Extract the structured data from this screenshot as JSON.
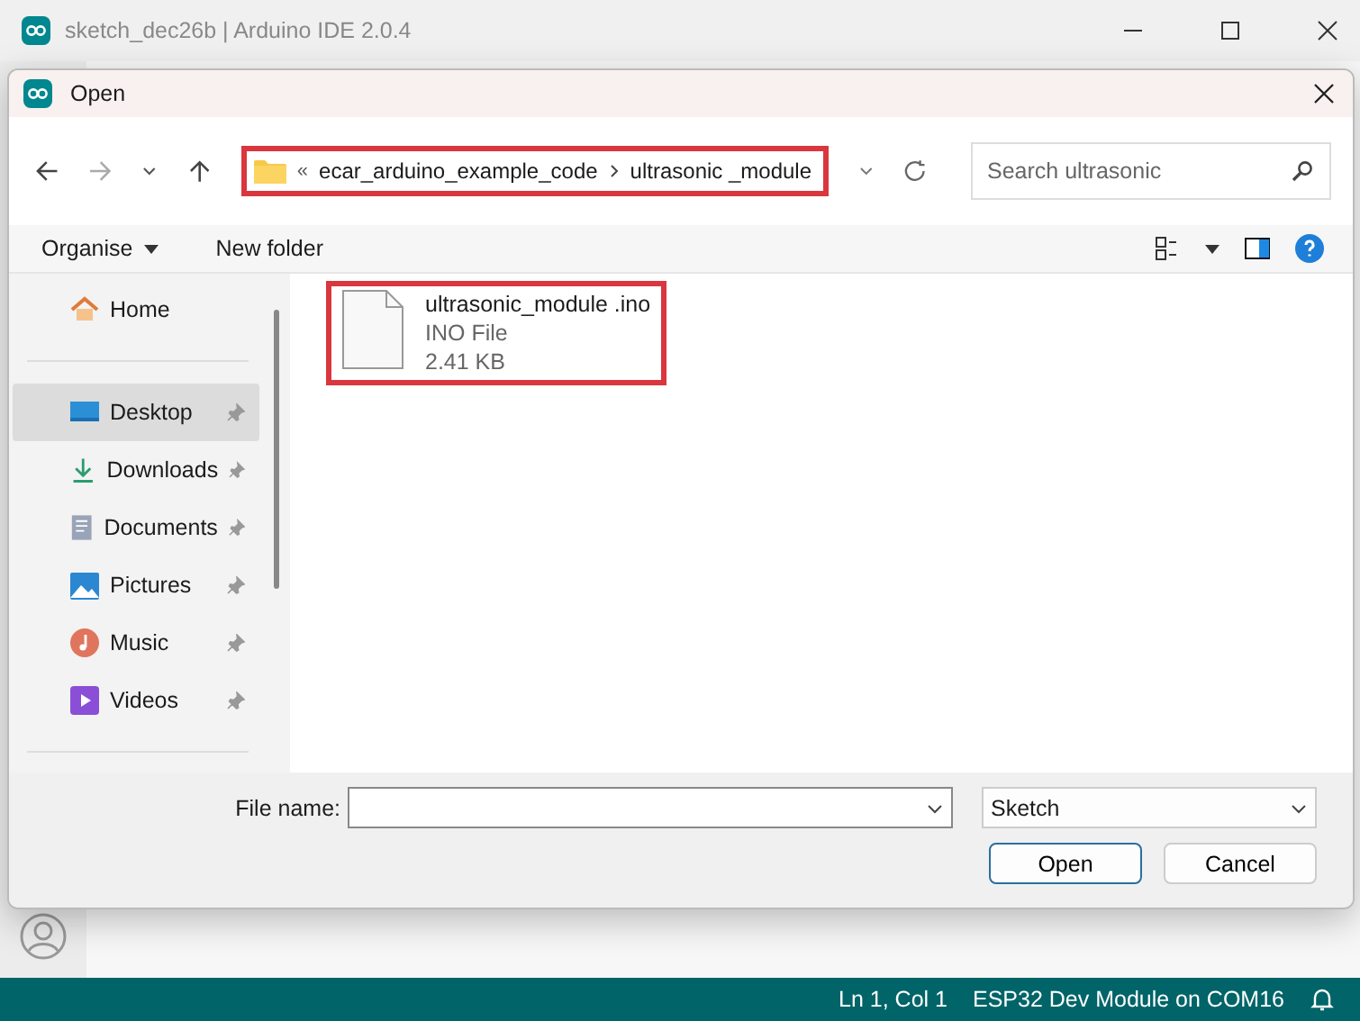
{
  "window": {
    "title": "sketch_dec26b | Arduino IDE 2.0.4"
  },
  "dialog": {
    "title": "Open",
    "address": {
      "overflow": "«",
      "segments": [
        "ecar_arduino_example_code",
        "ultrasonic _module"
      ],
      "highlighted": true
    },
    "search": {
      "placeholder": "Search ultrasonic"
    },
    "toolbar": {
      "organise": "Organise",
      "new_folder": "New folder"
    },
    "sidebar": {
      "sections": [
        {
          "items": [
            {
              "label": "Home",
              "kind": "home",
              "pinned": false,
              "selected": false
            }
          ]
        },
        {
          "items": [
            {
              "label": "Desktop",
              "kind": "desktop",
              "pinned": true,
              "selected": true
            },
            {
              "label": "Downloads",
              "kind": "downloads",
              "pinned": true,
              "selected": false
            },
            {
              "label": "Documents",
              "kind": "documents",
              "pinned": true,
              "selected": false
            },
            {
              "label": "Pictures",
              "kind": "pictures",
              "pinned": true,
              "selected": false
            },
            {
              "label": "Music",
              "kind": "music",
              "pinned": true,
              "selected": false
            },
            {
              "label": "Videos",
              "kind": "videos",
              "pinned": true,
              "selected": false
            }
          ]
        }
      ]
    },
    "files": [
      {
        "name": "ultrasonic_module .ino",
        "type": "INO File",
        "size": "2.41 KB",
        "highlighted": true
      }
    ],
    "file_name": {
      "label": "File name:"
    },
    "file_type": "Sketch",
    "buttons": [
      {
        "label": "Open",
        "default": true
      },
      {
        "label": "Cancel",
        "default": false
      }
    ]
  },
  "status_bar": {
    "position": "Ln 1, Col 1",
    "board": "ESP32 Dev Module on COM16"
  }
}
